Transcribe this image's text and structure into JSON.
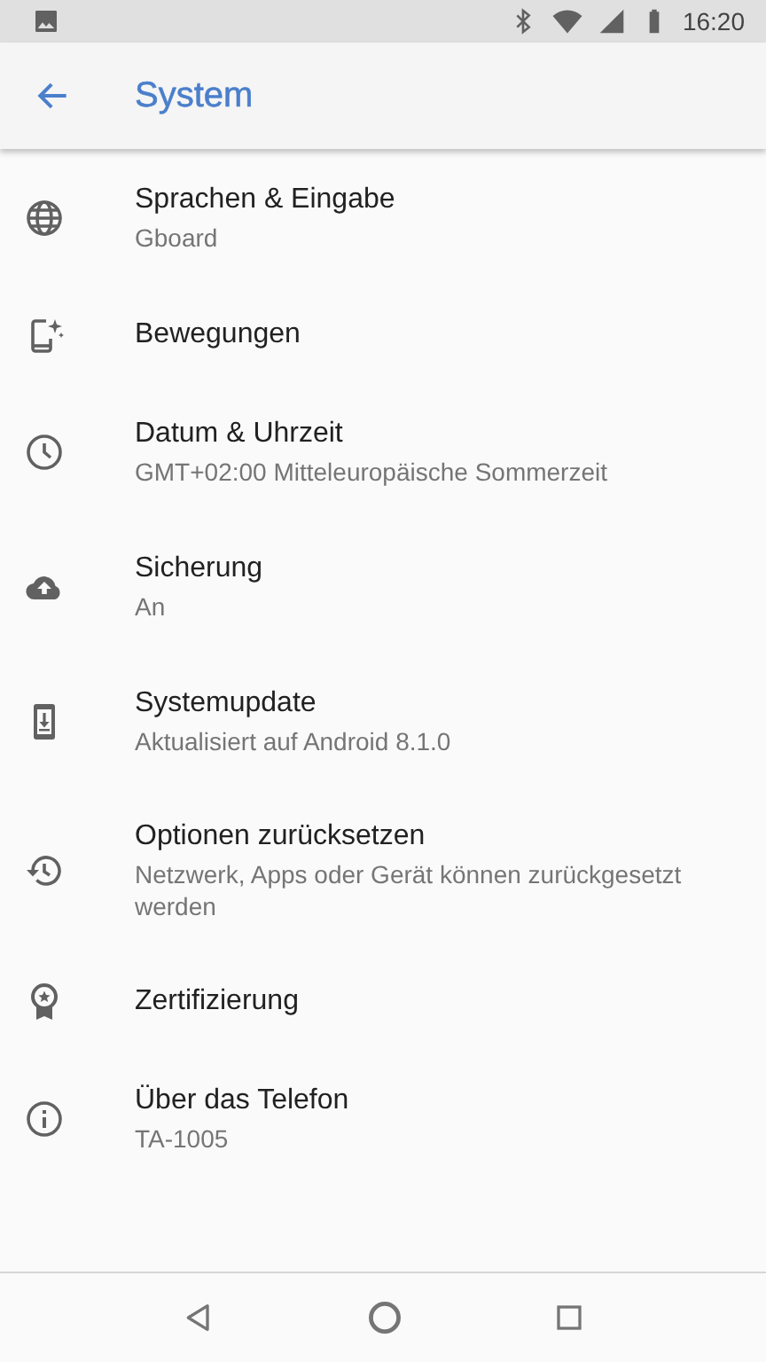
{
  "status_bar": {
    "time": "16:20"
  },
  "app_bar": {
    "title": "System"
  },
  "items": [
    {
      "title": "Sprachen & Eingabe",
      "summary": "Gboard"
    },
    {
      "title": "Bewegungen"
    },
    {
      "title": "Datum & Uhrzeit",
      "summary": "GMT+02:00 Mitteleuropäische Sommerzeit"
    },
    {
      "title": "Sicherung",
      "summary": "An"
    },
    {
      "title": "Systemupdate",
      "summary": "Aktualisiert auf Android 8.1.0"
    },
    {
      "title": "Optionen zurücksetzen",
      "summary": "Netzwerk, Apps oder Gerät können zurückgesetzt werden"
    },
    {
      "title": "Zertifizierung"
    },
    {
      "title": "Über das Telefon",
      "summary": "TA-1005"
    }
  ]
}
